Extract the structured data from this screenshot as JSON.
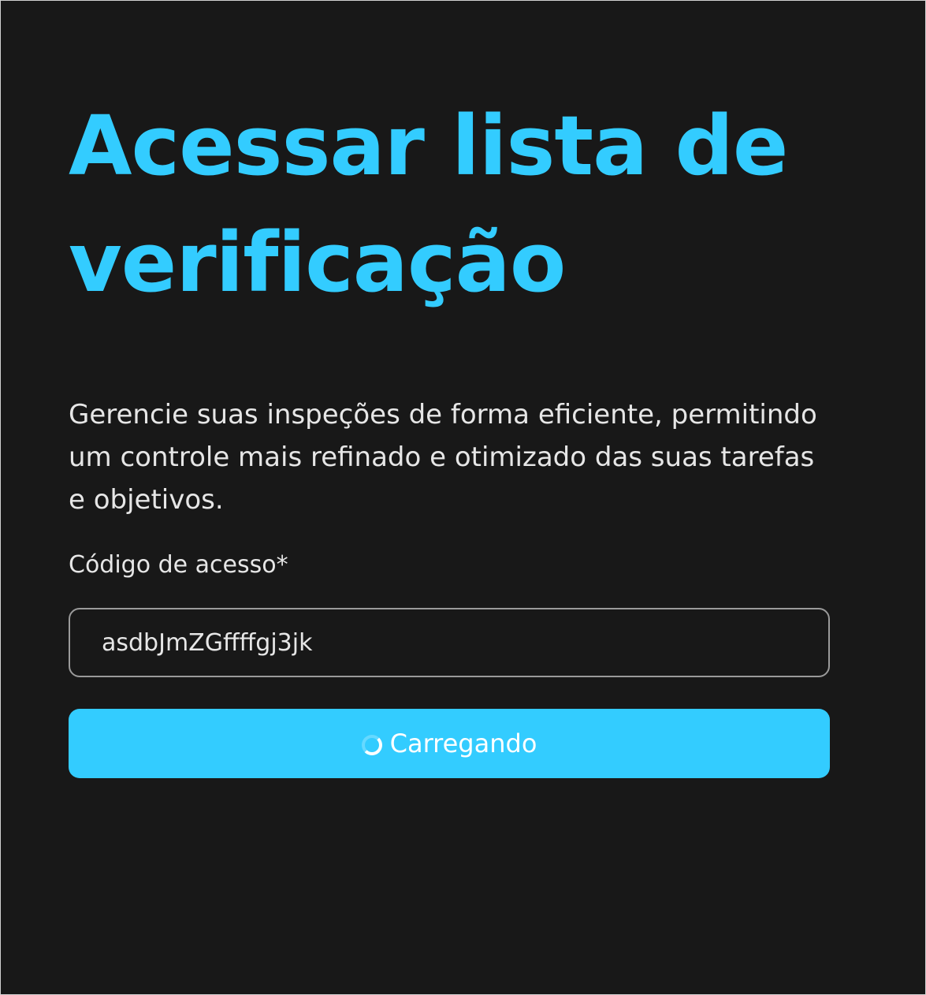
{
  "page": {
    "title": "Acessar lista de verificação",
    "description": "Gerencie suas inspeções de forma eficiente, permitindo um controle mais refinado e otimizado das suas tarefas e objetivos."
  },
  "form": {
    "access_code_label": "Código de acesso*",
    "access_code_value": "asdbJmZGffffgj3jk",
    "submit_label": "Carregando",
    "submit_state": "loading",
    "spinner_icon": "loading-spinner-icon"
  },
  "colors": {
    "background": "#181818",
    "accent": "#33ccff",
    "text": "#e6e6e6"
  }
}
